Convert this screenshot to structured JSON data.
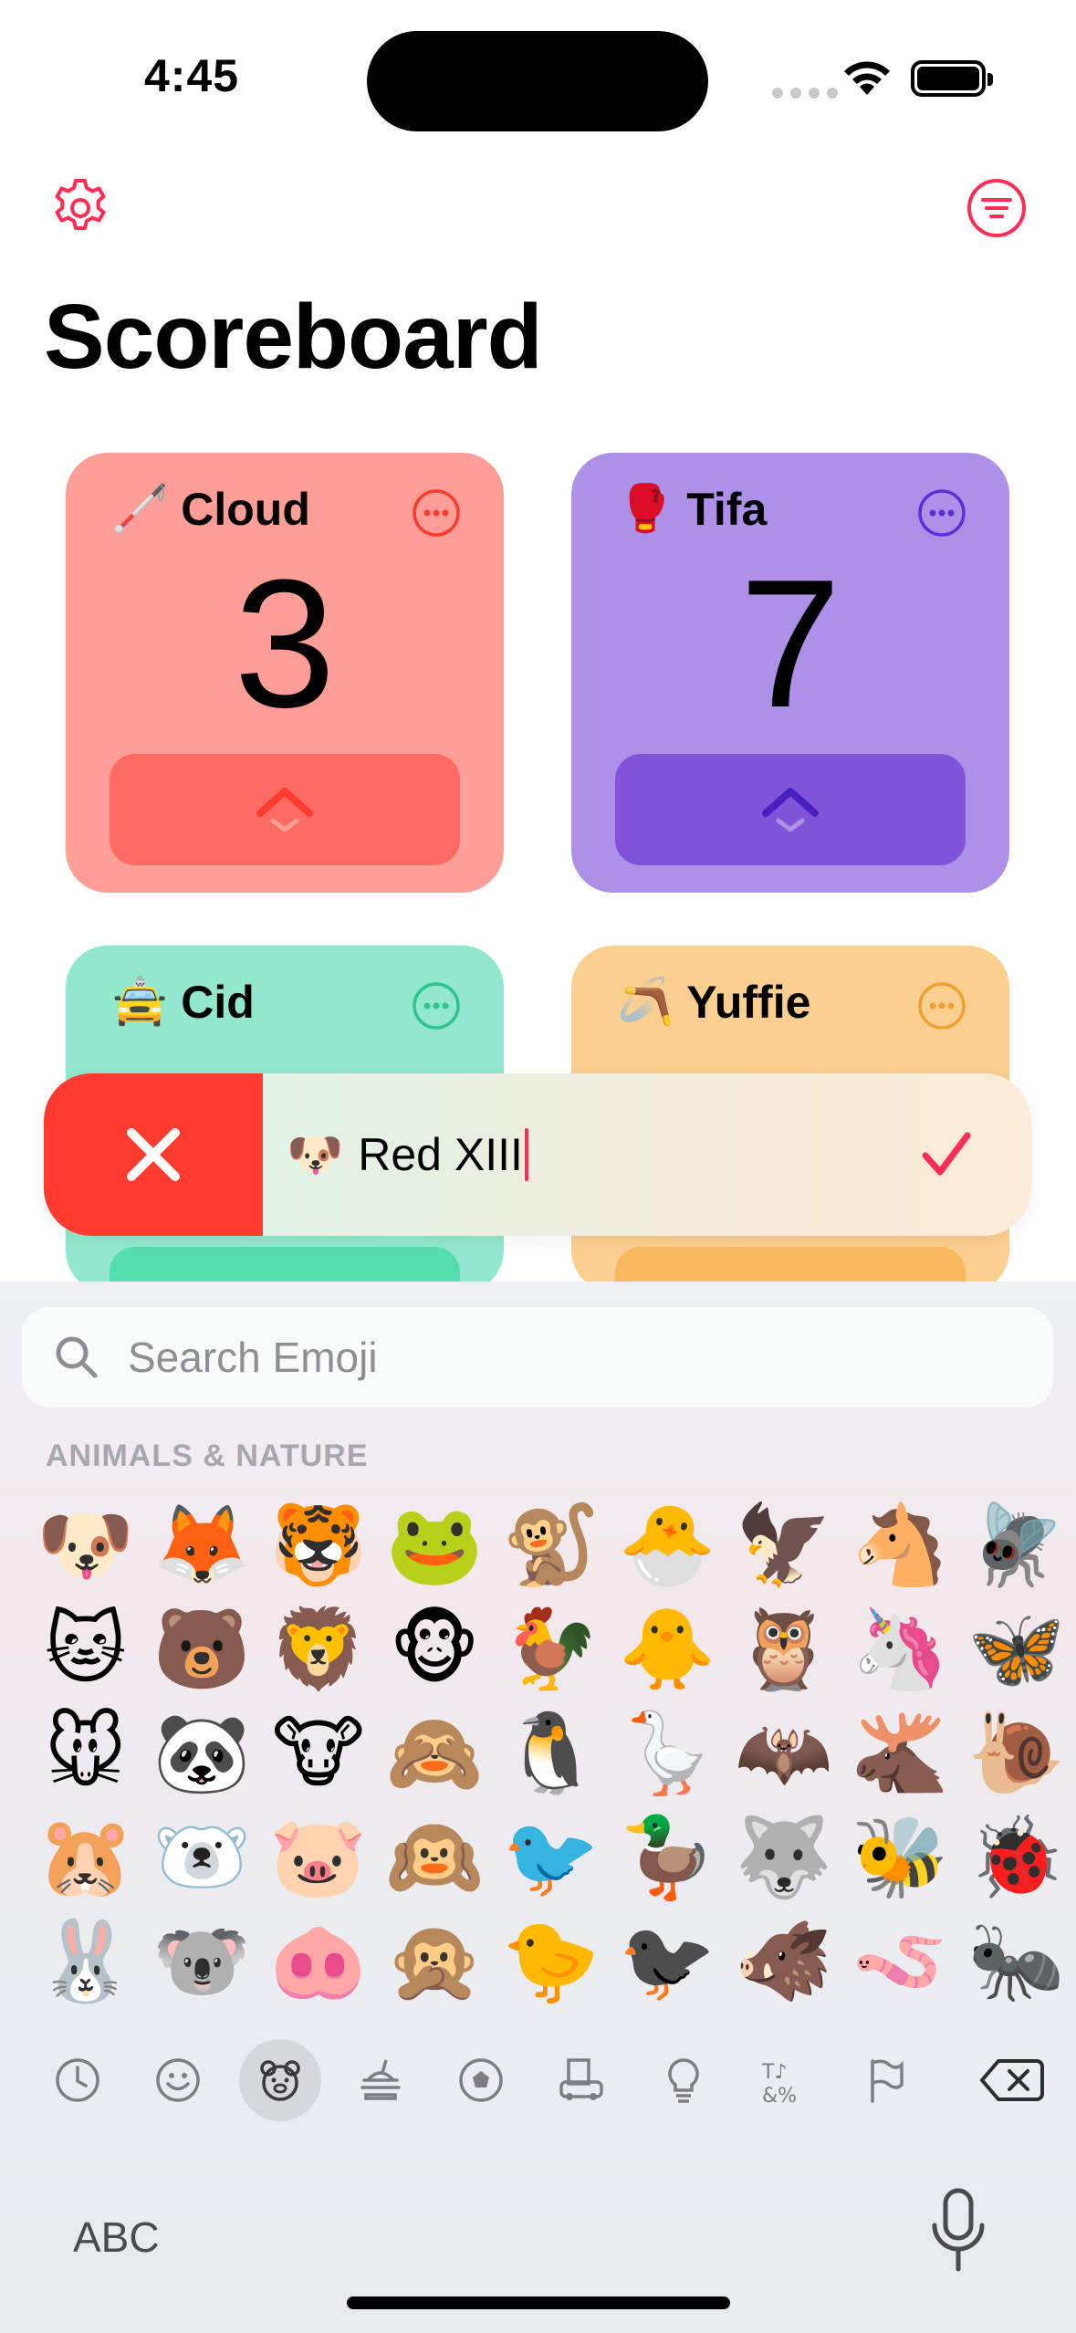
{
  "status_bar": {
    "time": "4:45"
  },
  "header": {
    "title": "Scoreboard",
    "settings_icon": "gear-icon",
    "filter_icon": "filter-icon"
  },
  "players": [
    {
      "name": "Cloud",
      "emoji": "🦯",
      "score": "3",
      "color": "#ff9e96",
      "accent": "#ff3b30"
    },
    {
      "name": "Tifa",
      "emoji": "🥊",
      "score": "7",
      "color": "#ad90e8",
      "accent": "#5e2fd6"
    },
    {
      "name": "Cid",
      "emoji": "🚖",
      "color": "#91e8cc",
      "accent": "#2fc48f"
    },
    {
      "name": "Yuffie",
      "emoji": "🪃",
      "color": "#fbcf8f",
      "accent": "#f0a030"
    }
  ],
  "edit": {
    "emoji": "🐶",
    "value": "Red XIII",
    "delete_icon": "close-icon",
    "confirm_icon": "checkmark-icon"
  },
  "keyboard": {
    "search_placeholder": "Search Emoji",
    "section": "ANIMALS & NATURE",
    "emoji_rows": [
      [
        "🐶",
        "🦊",
        "🐯",
        "🐸",
        "🐒",
        "🐣",
        "🦅",
        "🐴",
        "🪰"
      ],
      [
        "🐱",
        "🐻",
        "🦁",
        "🐵",
        "🐓",
        "🐥",
        "🦉",
        "🦄",
        "🦋"
      ],
      [
        "🐭",
        "🐼",
        "🐮",
        "🙈",
        "🐧",
        "🪿",
        "🦇",
        "🫎",
        "🐌"
      ],
      [
        "🐹",
        "🐻‍❄️",
        "🐷",
        "🙉",
        "🐦",
        "🦆",
        "🐺",
        "🐝",
        "🐞"
      ],
      [
        "🐰",
        "🐨",
        "🐽",
        "🙊",
        "🐤",
        "🐦‍⬛",
        "🐗",
        "🪱",
        "🐜"
      ]
    ],
    "categories": [
      "recent-icon",
      "smileys-icon",
      "animals-icon",
      "food-icon",
      "activity-icon",
      "travel-icon",
      "objects-icon",
      "symbols-icon",
      "flags-icon",
      "delete-key-icon"
    ],
    "abc_label": "ABC"
  }
}
